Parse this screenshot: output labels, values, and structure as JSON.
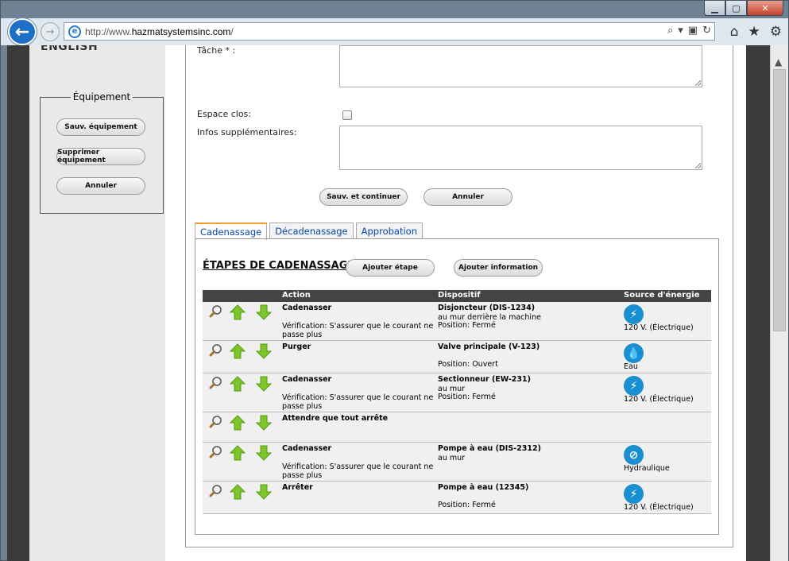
{
  "browser": {
    "url_prefix": "http://www.",
    "url_domain": "hazmatsystemsinc.com",
    "url_suffix": "/"
  },
  "sidebar": {
    "language_link": "ENGLISH",
    "equipment_legend": "Équipement",
    "save_equipment": "Sauv. équipement",
    "delete_equipment": "Supprimer équipement",
    "cancel": "Annuler"
  },
  "form": {
    "task_label": "Tâche * :",
    "confined_space_label": "Espace clos:",
    "extra_info_label": "Infos supplémentaires:",
    "save_continue": "Sauv. et continuer",
    "cancel": "Annuler"
  },
  "tabs": [
    {
      "label": "Cadenassage"
    },
    {
      "label": "Décadenassage"
    },
    {
      "label": "Approbation"
    }
  ],
  "panel": {
    "heading": "ÉTAPES DE CADENASSAGE",
    "add_step": "Ajouter étape",
    "add_info": "Ajouter information"
  },
  "table": {
    "headers": {
      "action": "Action",
      "device": "Dispositif",
      "energy": "Source d'énergie"
    },
    "rows": [
      {
        "action": "Cadenasser",
        "verification": "Vérification: S'assurer que le courant ne passe plus",
        "device": "Disjoncteur (DIS-1234)",
        "location": "au mur derrière la machine",
        "position": "Position: Fermé",
        "energy": "120 V. (Électrique)",
        "energy_icon": "lightning-icon"
      },
      {
        "action": "Purger",
        "verification": "",
        "device": "Valve principale (V-123)",
        "location": "",
        "position": "Position: Ouvert",
        "energy": "Eau",
        "energy_icon": "water-drop-icon"
      },
      {
        "action": "Cadenasser",
        "verification": "Vérification: S'assurer que le courant ne passe plus",
        "device": "Sectionneur (EW-231)",
        "location": "au mur",
        "position": "Position: Fermé",
        "energy": "120 V. (Électrique)",
        "energy_icon": "lightning-icon"
      },
      {
        "action": "Attendre que tout arrête",
        "verification": "",
        "device": "",
        "location": "",
        "position": "",
        "energy": "",
        "energy_icon": ""
      },
      {
        "action": "Cadenasser",
        "verification": "Vérification: S'assurer que le courant ne passe plus",
        "device": "Pompe à eau (DIS-2312)",
        "location": "au mur",
        "position": "",
        "energy": "Hydraulique",
        "energy_icon": "hydraulic-icon"
      },
      {
        "action": "Arrêter",
        "verification": "",
        "device": "Pompe à eau (12345)",
        "location": "",
        "position": "Position: Fermé",
        "energy": "120 V. (Électrique)",
        "energy_icon": "lightning-icon"
      }
    ]
  },
  "colors": {
    "accent_blue": "#1a8fd0",
    "arrow_green": "#6fc02a",
    "tab_active": "#f0a030"
  }
}
